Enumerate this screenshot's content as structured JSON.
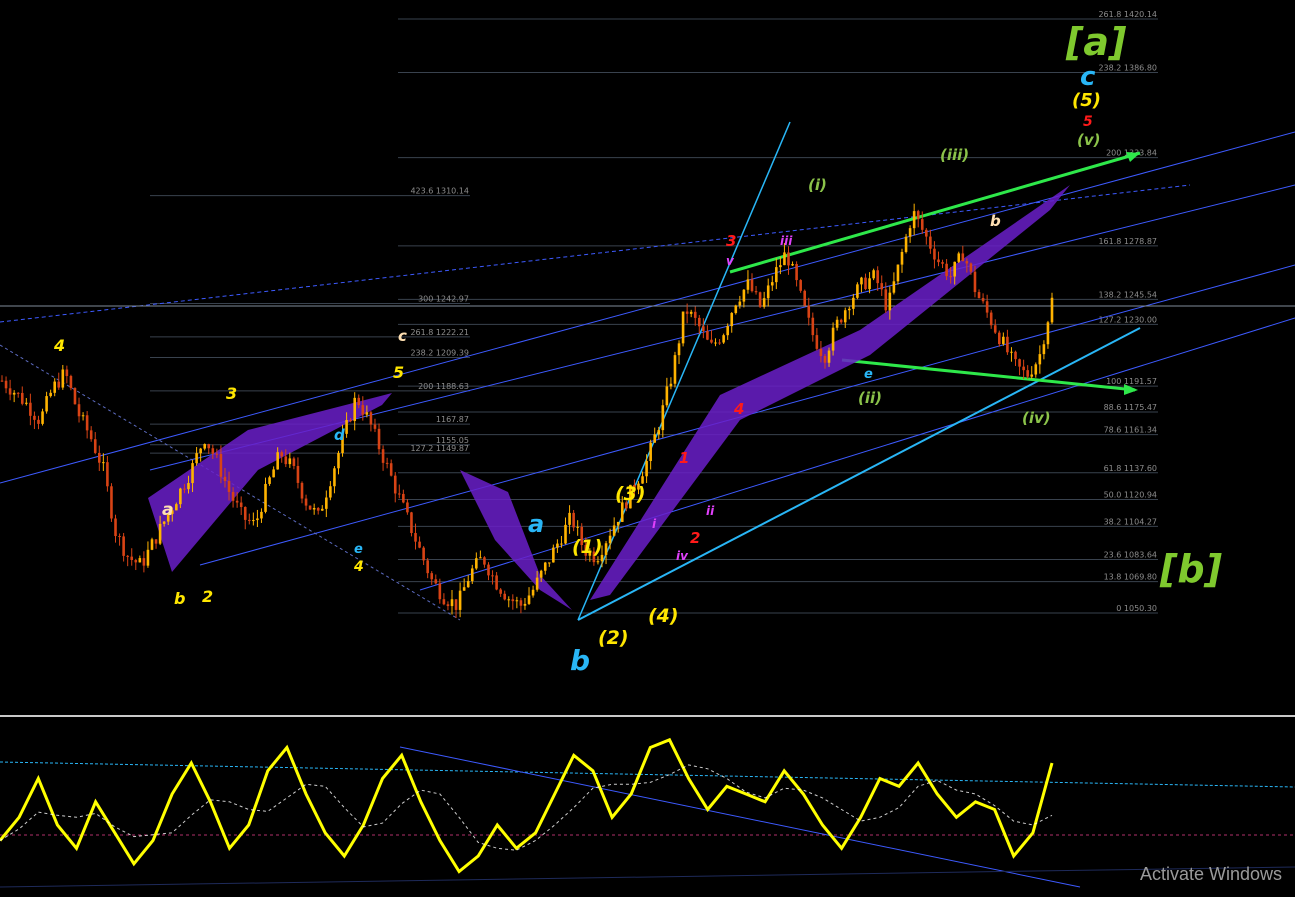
{
  "watermark": "Activate Windows",
  "fib_levels": [
    {
      "label": "261.8 1420.14",
      "price": 1420.14
    },
    {
      "label": "238.2 1386.80",
      "price": 1386.8
    },
    {
      "label": "200 1333.84",
      "price": 1333.84
    },
    {
      "label": "161.8 1278.87",
      "price": 1278.87
    },
    {
      "label": "138.2 1245.54",
      "price": 1245.54
    },
    {
      "label": "127.2 1230.00",
      "price": 1230.0
    },
    {
      "label": "100 1191.57",
      "price": 1191.57
    },
    {
      "label": "88.6 1175.47",
      "price": 1175.47
    },
    {
      "label": "78.6 1161.34",
      "price": 1161.34
    },
    {
      "label": "61.8 1137.60",
      "price": 1137.6
    },
    {
      "label": "50.0 1120.94",
      "price": 1120.94
    },
    {
      "label": "38.2 1104.27",
      "price": 1104.27
    },
    {
      "label": "23.6 1083.64",
      "price": 1083.64
    },
    {
      "label": "13.8 1069.80",
      "price": 1069.8
    },
    {
      "label": "0 1050.30",
      "price": 1050.3
    }
  ],
  "fib_levels_secondary": [
    {
      "label": "423.6 1310.14",
      "price": 1310.14
    },
    {
      "label": "300 1242.97",
      "price": 1242.97
    },
    {
      "label": "261.8 1222.21",
      "price": 1222.21
    },
    {
      "label": "238.2 1209.39",
      "price": 1209.39
    },
    {
      "label": "200 1188.63",
      "price": 1188.63
    },
    {
      "label": "1167.87",
      "price": 1167.87
    },
    {
      "label": "1155.05",
      "price": 1155.05
    },
    {
      "label": "127.2 1149.87",
      "price": 1149.87
    }
  ],
  "wave_labels": [
    {
      "text": "[a]",
      "color": "#7fc92e"
    },
    {
      "text": "[b]",
      "color": "#7fc92e"
    },
    {
      "text": "c",
      "color": "#29b6f6"
    },
    {
      "text": "(5)",
      "color": "#ffe600"
    },
    {
      "text": "5",
      "color": "#ff1a1a"
    },
    {
      "text": "(v)",
      "color": "#8bc34a"
    },
    {
      "text": "(iii)",
      "color": "#8bc34a"
    },
    {
      "text": "(i)",
      "color": "#8bc34a"
    },
    {
      "text": "(ii)",
      "color": "#8bc34a"
    },
    {
      "text": "(iv)",
      "color": "#8bc34a"
    },
    {
      "text": "a",
      "color": "#29b6f6"
    },
    {
      "text": "b",
      "color": "#29b6f6"
    },
    {
      "text": "(1)",
      "color": "#ffe600"
    },
    {
      "text": "(2)",
      "color": "#ffe600"
    },
    {
      "text": "(3)",
      "color": "#ffe600"
    },
    {
      "text": "(4)",
      "color": "#ffe600"
    },
    {
      "text": "3",
      "color": "#ff1a1a"
    },
    {
      "text": "4",
      "color": "#ff1a1a"
    },
    {
      "text": "2",
      "color": "#ff1a1a"
    },
    {
      "text": "1",
      "color": "#ff1a1a"
    },
    {
      "text": "3",
      "color": "#ffe600"
    },
    {
      "text": "4",
      "color": "#ffe600"
    },
    {
      "text": "5",
      "color": "#ffe600"
    },
    {
      "text": "2",
      "color": "#ffe600"
    },
    {
      "text": "b",
      "color": "#ffe600"
    },
    {
      "text": "c",
      "color": "#ffe0b2"
    },
    {
      "text": "a",
      "color": "#ffe0b2"
    },
    {
      "text": "b",
      "color": "#ffe0b2"
    },
    {
      "text": "d",
      "color": "#29b6f6"
    },
    {
      "text": "e",
      "color": "#29b6f6"
    },
    {
      "text": "e",
      "color": "#ffe600"
    },
    {
      "text": "4",
      "color": "#ffe600"
    },
    {
      "text": "iii",
      "color": "#e040fb"
    },
    {
      "text": "iv",
      "color": "#e040fb"
    },
    {
      "text": "v",
      "color": "#e040fb"
    },
    {
      "text": "ii",
      "color": "#e040fb"
    },
    {
      "text": "i",
      "color": "#e040fb"
    }
  ],
  "colors": {
    "background": "#000000",
    "grid_line": "#39424e",
    "trend_blue": "#3d5afe",
    "trend_cyan": "#29b6f6",
    "trend_green": "#2ee84a",
    "purple_band": "#7e2fd6",
    "candle_up": "#ffb300",
    "candle_down": "#d84315",
    "oscillator": "#ffff00"
  },
  "chart_data": [
    {
      "type": "line",
      "title": "",
      "xlabel": "",
      "ylabel": "",
      "y_range_approx": [
        1040,
        1430
      ],
      "series": [
        {
          "values": [
            1195,
            1188,
            1180,
            1170,
            1190,
            1200,
            1175,
            1160,
            1140,
            1100,
            1085,
            1080,
            1095,
            1110,
            1125,
            1140,
            1160,
            1145,
            1125,
            1110,
            1105,
            1130,
            1150,
            1140,
            1120,
            1110,
            1135,
            1160,
            1185,
            1170,
            1150,
            1130,
            1110,
            1090,
            1070,
            1060,
            1055,
            1075,
            1085,
            1070,
            1060,
            1055,
            1065,
            1080,
            1095,
            1110,
            1090,
            1085,
            1100,
            1115,
            1130,
            1145,
            1170,
            1200,
            1240,
            1230,
            1215,
            1225,
            1245,
            1255,
            1240,
            1260,
            1275,
            1250,
            1225,
            1210,
            1230,
            1245,
            1255,
            1260,
            1240,
            1270,
            1300,
            1285,
            1270,
            1260,
            1275,
            1250,
            1235,
            1220,
            1205,
            1198,
            1210,
            1245
          ]
        }
      ]
    },
    {
      "type": "line",
      "title": "",
      "series": [
        {
          "values": [
            30,
            45,
            70,
            40,
            25,
            55,
            35,
            15,
            30,
            60,
            80,
            55,
            25,
            40,
            75,
            90,
            60,
            35,
            20,
            40,
            70,
            85,
            55,
            30,
            10,
            20,
            40,
            25,
            35,
            60,
            85,
            75,
            45,
            60,
            90,
            95,
            70,
            50,
            65,
            60,
            55,
            75,
            60,
            40,
            25,
            45,
            70,
            65,
            80,
            60,
            45,
            55,
            50,
            20,
            35,
            80
          ]
        }
      ]
    }
  ]
}
